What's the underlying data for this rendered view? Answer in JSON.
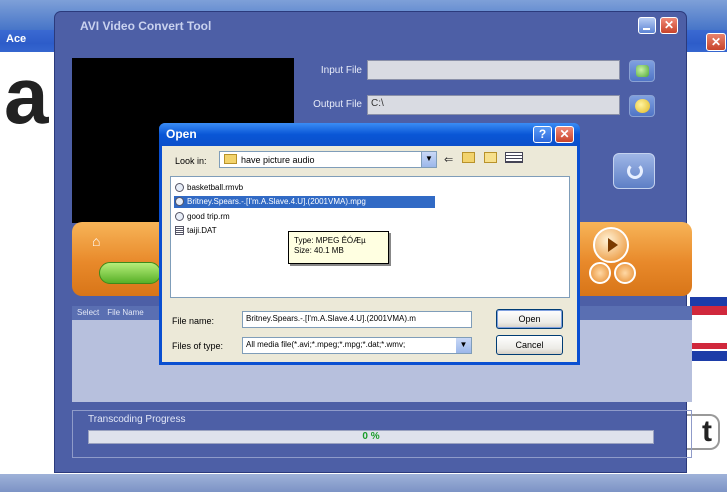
{
  "background": {
    "window_title": "Ace",
    "big_letter": "a",
    "close_glyph": "✕",
    "side_letter": "t"
  },
  "app": {
    "title": "AVI Video Convert Tool",
    "minimize_glyph": "",
    "close_glyph": "✕",
    "input_label": "Input File",
    "input_value": "",
    "output_label": "Output File",
    "output_value": "C:\\",
    "list_header": [
      "Select",
      "File Name"
    ],
    "progress_label": "Transcoding Progress",
    "progress_text": "0 %",
    "progress_fraction": 0,
    "home_icon": "⌂"
  },
  "dialog": {
    "title": "Open",
    "help_glyph": "?",
    "close_glyph": "✕",
    "look_in_label": "Look in:",
    "look_in_value": "have picture audio",
    "toolbar": {
      "back": "⇐",
      "dropdown": "▼"
    },
    "files": [
      {
        "name": "basketball.rmvb",
        "icon": "media-file-icon"
      },
      {
        "name": "Britney.Spears.-.[I'm.A.Slave.4.U].(2001VMA).mpg",
        "icon": "media-file-icon",
        "selected": true
      },
      {
        "name": "good trip.rm",
        "icon": "media-file-icon"
      },
      {
        "name": "taiji.DAT",
        "icon": "dat-file-icon"
      }
    ],
    "tooltip": {
      "type_line": "Type: MPEG ÊÓÆµ",
      "size_line": "Size: 40.1 MB"
    },
    "file_name_label": "File name:",
    "file_name_value": "Britney.Spears.-.[I'm.A.Slave.4.U].(2001VMA).m",
    "files_of_type_label": "Files of type:",
    "files_of_type_value": "All media file(*.avi;*.mpeg;*.mpg;*.dat;*.wmv;",
    "open_button": "Open",
    "cancel_button": "Cancel"
  },
  "colors": {
    "dialog_titlebar": "#0a56d6",
    "app_body": "#4d5fa6",
    "orange_panel": "#e8892a",
    "selection": "#316ac5",
    "progress_text": "#1a9c2a"
  }
}
